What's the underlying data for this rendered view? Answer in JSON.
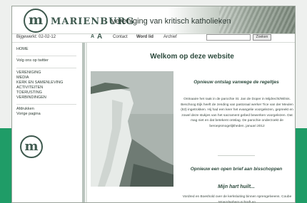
{
  "site": {
    "logo_letter": "m",
    "title": "MARIENBURG",
    "subtitle": "vereniging van kritisch katholieken"
  },
  "toolbar": {
    "updated": "Bijgewerkt: 02-02-12",
    "font_small": "A",
    "font_large": "A",
    "nav": {
      "contact": "Contact",
      "word_lid": "Word lid",
      "archief": "Archief"
    },
    "search_placeholder": "",
    "search_button": "Zoeken"
  },
  "sidebar": {
    "home": "HOME",
    "twitter": "Volg ons op twitter",
    "items": [
      "VERENIGING",
      "MEDIA",
      "KERK EN SAMENLEVING",
      "ACTIVITEITEN",
      "TOERUSTING",
      "VERBINDINGEN"
    ],
    "afdrukken": "Afdrukken",
    "vorige": "Vorige pagina",
    "logo_letter": "m"
  },
  "main": {
    "heading": "Welkom op deze website",
    "article1": {
      "title": "Opnieuw ontslag vanwege de regeltjes",
      "body": "Ontnaaire het raak in de parochie St. Jan de Doper in Mijdrecht/Wilnis. Beschoog Eijk heeft de zending van pastoraal werker Tice van der Meulen (63) ingetrokken. Hij had een keer het evangelie voorgelezen, gepreekt en zowel deze stukjes van het sacrament gebed bewerken voorgelezen. Dat mag niet en dat betekent ontslag. De parochie onderzoekt de beroepsmogelijkheden. januari 2012"
    },
    "article2": {
      "title": "Opnieuw een open brief aan bisschoppen",
      "subtitle": "Mijn hart huilt...",
      "body": "Vordred en Boeshold over de kerksluiting binnen sprengelveens. Coube Moegdeeberg schreft en"
    }
  },
  "colors": {
    "accent": "#3f5a4f",
    "backdrop_green": "#1f9c67"
  }
}
